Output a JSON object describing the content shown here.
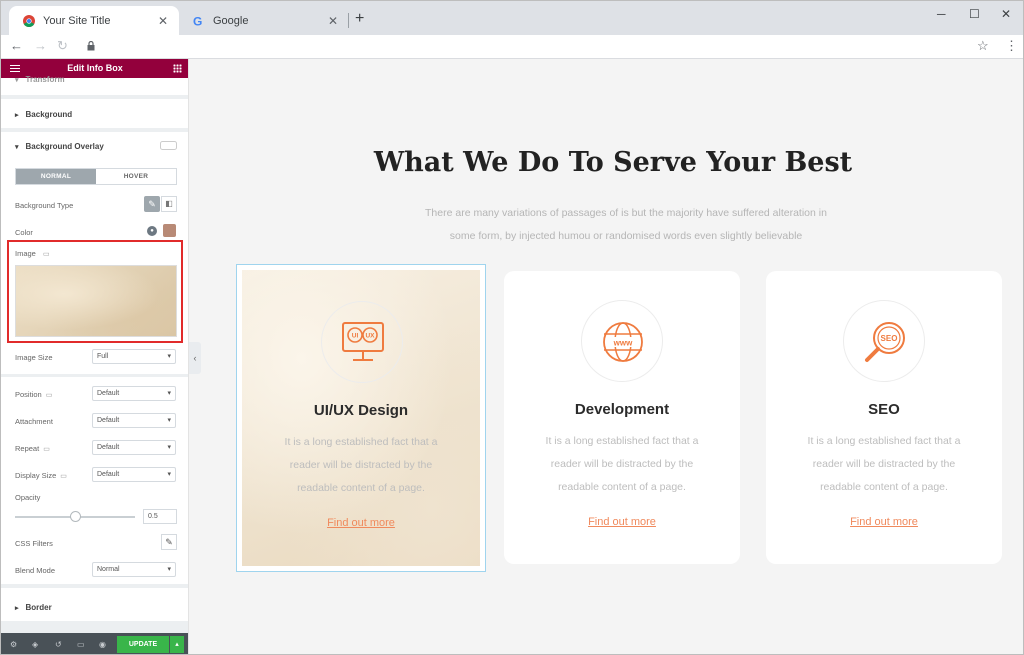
{
  "browser": {
    "tabs": [
      {
        "title": "Your Site Title"
      },
      {
        "title": "Google"
      }
    ]
  },
  "editor": {
    "title": "Edit Info Box",
    "sections": {
      "transform": "Transform",
      "background": "Background",
      "background_overlay": "Background Overlay",
      "border": "Border"
    },
    "toggle": {
      "normal": "NORMAL",
      "hover": "HOVER"
    },
    "fields": {
      "background_type": "Background Type",
      "color": "Color",
      "image": "Image",
      "image_size": {
        "label": "Image Size",
        "value": "Full"
      },
      "position": {
        "label": "Position",
        "value": "Default"
      },
      "attachment": {
        "label": "Attachment",
        "value": "Default"
      },
      "repeat": {
        "label": "Repeat",
        "value": "Default"
      },
      "display_size": {
        "label": "Display Size",
        "value": "Default"
      },
      "opacity": {
        "label": "Opacity",
        "value": "0.5",
        "level": 0.5
      },
      "css_filters": "CSS Filters",
      "blend_mode": {
        "label": "Blend Mode",
        "value": "Normal"
      }
    },
    "update_label": "UPDATE",
    "colors": {
      "header": "#93003c",
      "update": "#39b54a",
      "overlay_color": "#b88a76"
    }
  },
  "page": {
    "heading": "What We Do To Serve Your Best",
    "description_line1": "There are many variations of passages of is but the majority have suffered alteration in",
    "description_line2": "some form, by injected humou or randomised words even slightly believable",
    "cards": [
      {
        "icon": "ui-ux-monitor-icon",
        "icon_text": "UI UX",
        "title": "UI/UX Design",
        "text": [
          "It is a long established fact that a",
          "reader will be distracted by the",
          "readable content of a page."
        ],
        "link": "Find out more"
      },
      {
        "icon": "www-globe-icon",
        "icon_text": "www",
        "title": "Development",
        "text": [
          "It is a long established fact that a",
          "reader will be distracted by the",
          "readable content of a page."
        ],
        "link": "Find out more"
      },
      {
        "icon": "seo-magnifier-icon",
        "icon_text": "SEO",
        "title": "SEO",
        "text": [
          "It is a long established fact that a",
          "reader will be distracted by the",
          "readable content of a page."
        ],
        "link": "Find out more"
      }
    ],
    "accent": "#f08a5d"
  }
}
